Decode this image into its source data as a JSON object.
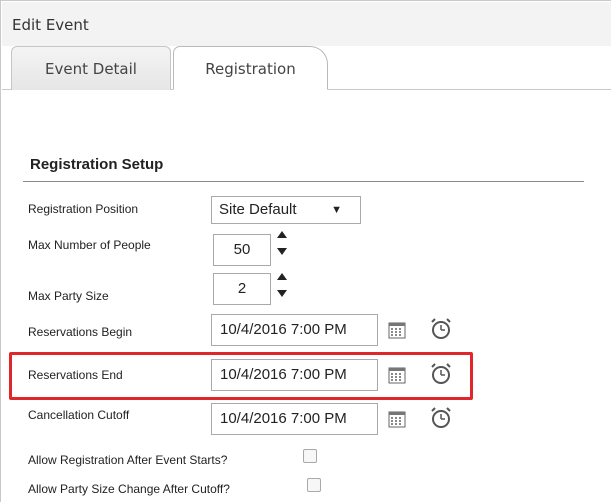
{
  "window": {
    "title": "Edit Event"
  },
  "tabs": [
    {
      "label": "Event Detail",
      "active": false
    },
    {
      "label": "Registration",
      "active": true
    }
  ],
  "section": {
    "title": "Registration Setup"
  },
  "fields": {
    "registration_position": {
      "label": "Registration Position",
      "value": "Site Default",
      "caret": "▼"
    },
    "max_people": {
      "label": "Max Number of People",
      "value": "50"
    },
    "max_party_size": {
      "label": "Max Party Size",
      "value": "2"
    },
    "reservations_begin": {
      "label": "Reservations Begin",
      "value": "10/4/2016 7:00 PM"
    },
    "reservations_end": {
      "label": "Reservations End",
      "value": "10/4/2016 7:00 PM"
    },
    "cancellation_cutoff": {
      "label": "Cancellation Cutoff",
      "value": "10/4/2016 7:00 PM"
    },
    "allow_after_start": {
      "label": "Allow Registration After Event Starts?",
      "checked": false
    },
    "allow_party_change": {
      "label": "Allow Party Size Change After Cutoff?",
      "checked": false
    }
  },
  "icons": {
    "calendar": "calendar-icon",
    "clock": "clock-icon",
    "step_up": "chevron-up-icon",
    "step_down": "chevron-down-icon"
  },
  "colors": {
    "highlight": "#e0252b",
    "title_bar": "#f3f3f3",
    "border": "#a9a9a9"
  }
}
